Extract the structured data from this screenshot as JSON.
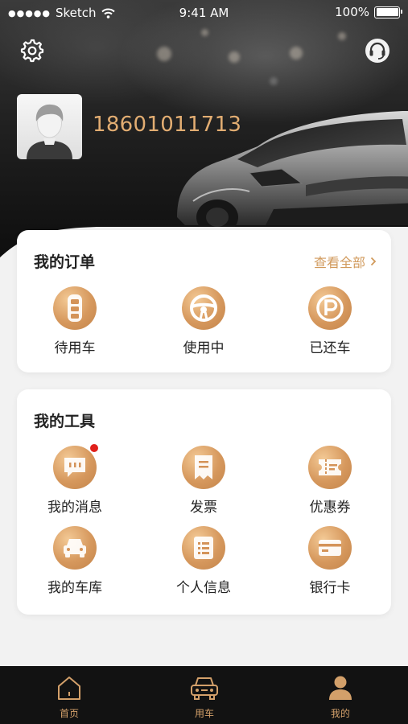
{
  "status_bar": {
    "carrier": "Sketch",
    "time": "9:41 AM",
    "battery": "100%"
  },
  "header": {
    "settings_icon": "gear-icon",
    "service_icon": "headset-icon",
    "phone": "18601011713"
  },
  "orders": {
    "title": "我的订单",
    "view_all": "查看全部",
    "items": [
      {
        "label": "待用车",
        "icon": "car-key-icon"
      },
      {
        "label": "使用中",
        "icon": "steering-wheel-icon"
      },
      {
        "label": "已还车",
        "icon": "parking-icon"
      }
    ]
  },
  "tools": {
    "title": "我的工具",
    "items": [
      {
        "label": "我的消息",
        "icon": "message-icon",
        "badge": true
      },
      {
        "label": "发票",
        "icon": "invoice-icon"
      },
      {
        "label": "优惠券",
        "icon": "coupon-icon"
      },
      {
        "label": "我的车库",
        "icon": "garage-car-icon"
      },
      {
        "label": "个人信息",
        "icon": "profile-list-icon"
      },
      {
        "label": "银行卡",
        "icon": "bank-card-icon"
      }
    ]
  },
  "tabbar": {
    "items": [
      {
        "label": "首页",
        "icon": "home-icon"
      },
      {
        "label": "用车",
        "icon": "car-icon"
      },
      {
        "label": "我的",
        "icon": "user-icon",
        "active": true
      }
    ]
  },
  "colors": {
    "accent": "#d19a5c",
    "phone": "#e2ad72",
    "tabbar_bg": "#121212",
    "page_bg": "#f2f2f2",
    "badge": "#e0201b"
  }
}
